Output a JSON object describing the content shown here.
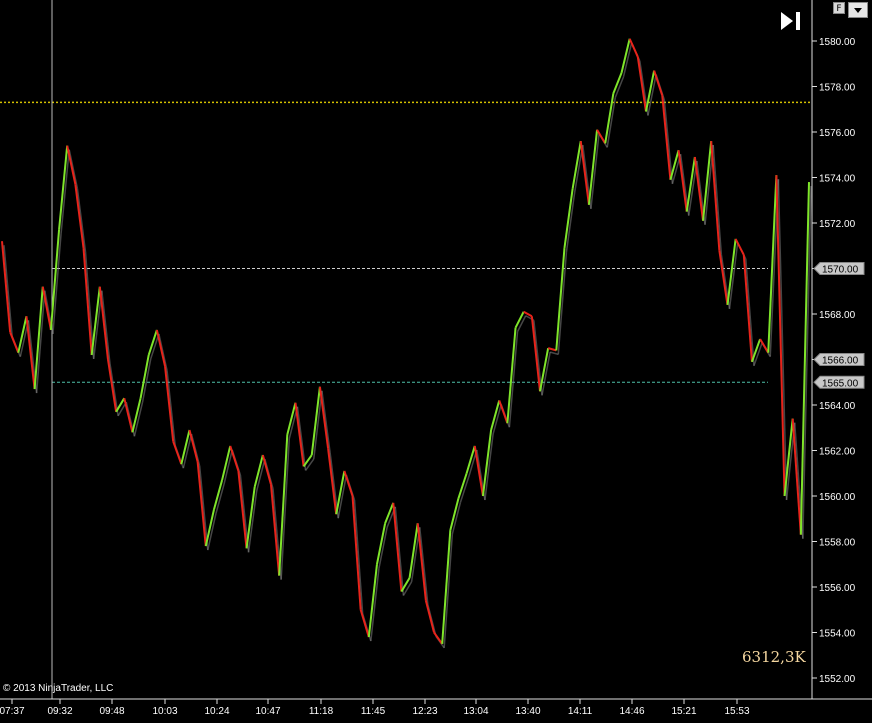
{
  "toolbar": {
    "f_label": "F"
  },
  "status": {
    "volume": "6312,3K",
    "copyright": "© 2013 NinjaTrader, LLC"
  },
  "colors": {
    "up": "#7fe52a",
    "down": "#e8231a",
    "gray": "#808080",
    "ref_line": "#d4c100",
    "level_line": "#cfcfcf",
    "teal_line": "#4dbfa8"
  },
  "chart_data": {
    "type": "line",
    "ylim": [
      1551,
      1581
    ],
    "yticks": [
      "1580.00",
      "1578.00",
      "1576.00",
      "1574.00",
      "1572.00",
      "1570.00",
      "1568.00",
      "1566.00",
      "1564.00",
      "1562.00",
      "1560.00",
      "1558.00",
      "1556.00",
      "1554.00",
      "1552.00"
    ],
    "xticks": [
      "07:37",
      "09:32",
      "09:48",
      "10:03",
      "10:24",
      "10:47",
      "11:18",
      "11:45",
      "12:23",
      "13:04",
      "13:40",
      "14:11",
      "14:46",
      "15:21",
      "15:53"
    ],
    "reference_line": 1577.3,
    "level_tags": [
      "1570.00",
      "1566.00",
      "1565.00"
    ],
    "horizontal_levels": [
      1570.0,
      1565.0
    ],
    "crosshair_time": "09:32",
    "series": [
      {
        "values": [
          1571.2,
          1567.2,
          1566.3,
          1567.9,
          1564.7,
          1569.2,
          1567.3,
          1571.7,
          1575.4,
          1573.7,
          1570.9,
          1566.2,
          1569.2,
          1566.0,
          1563.7,
          1564.3,
          1562.8,
          1564.3,
          1566.2,
          1567.3,
          1565.7,
          1562.4,
          1561.4,
          1562.9,
          1561.5,
          1557.8,
          1559.4,
          1560.7,
          1562.2,
          1561.1,
          1557.7,
          1560.4,
          1561.8,
          1560.5,
          1556.5,
          1562.7,
          1564.1,
          1561.3,
          1561.8,
          1564.8,
          1562.1,
          1559.2,
          1561.1,
          1560.0,
          1555.0,
          1553.8,
          1557.0,
          1558.8,
          1559.7,
          1555.8,
          1556.4,
          1558.8,
          1555.4,
          1554.0,
          1553.5,
          1558.5,
          1559.9,
          1561.0,
          1562.2,
          1560.0,
          1562.9,
          1564.2,
          1563.2,
          1567.4,
          1568.1,
          1567.9,
          1564.6,
          1566.5,
          1566.4,
          1570.9,
          1573.5,
          1575.6,
          1572.8,
          1576.1,
          1575.5,
          1577.7,
          1578.6,
          1580.1,
          1579.3,
          1576.9,
          1578.7,
          1577.6,
          1573.9,
          1575.2,
          1572.5,
          1574.9,
          1572.1,
          1575.6,
          1570.8,
          1568.4,
          1571.3,
          1570.6,
          1565.9,
          1566.9,
          1566.3,
          1574.1,
          1560.0,
          1563.4,
          1558.3,
          1573.8
        ]
      }
    ]
  }
}
